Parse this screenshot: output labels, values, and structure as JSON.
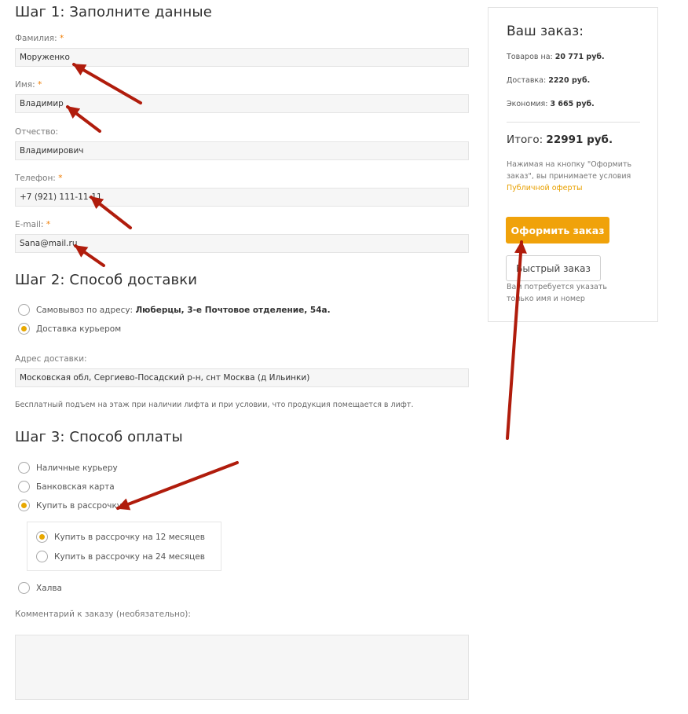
{
  "colors": {
    "accent": "#f0a20a",
    "required": "#f07c00",
    "arrow": "#b01c0c"
  },
  "step1": {
    "title": "Шаг 1: Заполните данные",
    "fields": [
      {
        "label": "Фамилия:",
        "required": "*",
        "value": "Моруженко"
      },
      {
        "label": "Имя:",
        "required": "*",
        "value": "Владимир"
      },
      {
        "label": "Отчество:",
        "required": "",
        "value": "Владимирович"
      },
      {
        "label": "Телефон:",
        "required": "*",
        "value": "+7 (921) 111-11-11"
      },
      {
        "label": "E-mail:",
        "required": "*",
        "value": "Sana@mail.ru"
      }
    ]
  },
  "step2": {
    "title": "Шаг 2: Способ доставки",
    "options": [
      {
        "prefix": "Самовывоз по адресу:",
        "bold": "Люберцы, 3-е Почтовое отделение, 54а.",
        "checked": false
      },
      {
        "prefix": "Доставка курьером",
        "bold": "",
        "checked": true
      }
    ],
    "address_label": "Адрес доставки:",
    "address_value": "Московская обл, Сергиево-Посадский р-н, снт Москва (д Ильинки)",
    "note": "Бесплатный подъем на этаж при наличии лифта и при условии, что продукция помещается в лифт."
  },
  "step3": {
    "title": "Шаг 3: Способ оплаты",
    "options": [
      {
        "label": "Наличные курьеру",
        "checked": false
      },
      {
        "label": "Банковская карта",
        "checked": false
      },
      {
        "label": "Купить в рассрочку",
        "checked": true
      }
    ],
    "installment_options": [
      {
        "label": "Купить в рассрочку на 12 месяцев",
        "checked": true
      },
      {
        "label": "Купить в рассрочку на 24 месяцев",
        "checked": false
      }
    ],
    "last_option": {
      "label": "Халва",
      "checked": false
    },
    "comment_label": "Комментарий к заказу (необязательно):"
  },
  "order": {
    "title": "Ваш заказ:",
    "goods_label": "Товаров на:",
    "goods_value": "20 771 руб.",
    "delivery_label": "Доставка:",
    "delivery_value": "2220 руб.",
    "savings_label": "Экономия:",
    "savings_value": "3 665 руб.",
    "total_label": "Итого:",
    "total_value": "22991 руб.",
    "terms_text": "Нажимая на кнопку \"Оформить заказ\", вы принимаете условия",
    "terms_link": "Публичной оферты",
    "submit_label": "Оформить заказ",
    "quick_label": "Быстрый заказ",
    "quick_note": "Вам потребуется указать только имя и номер"
  }
}
